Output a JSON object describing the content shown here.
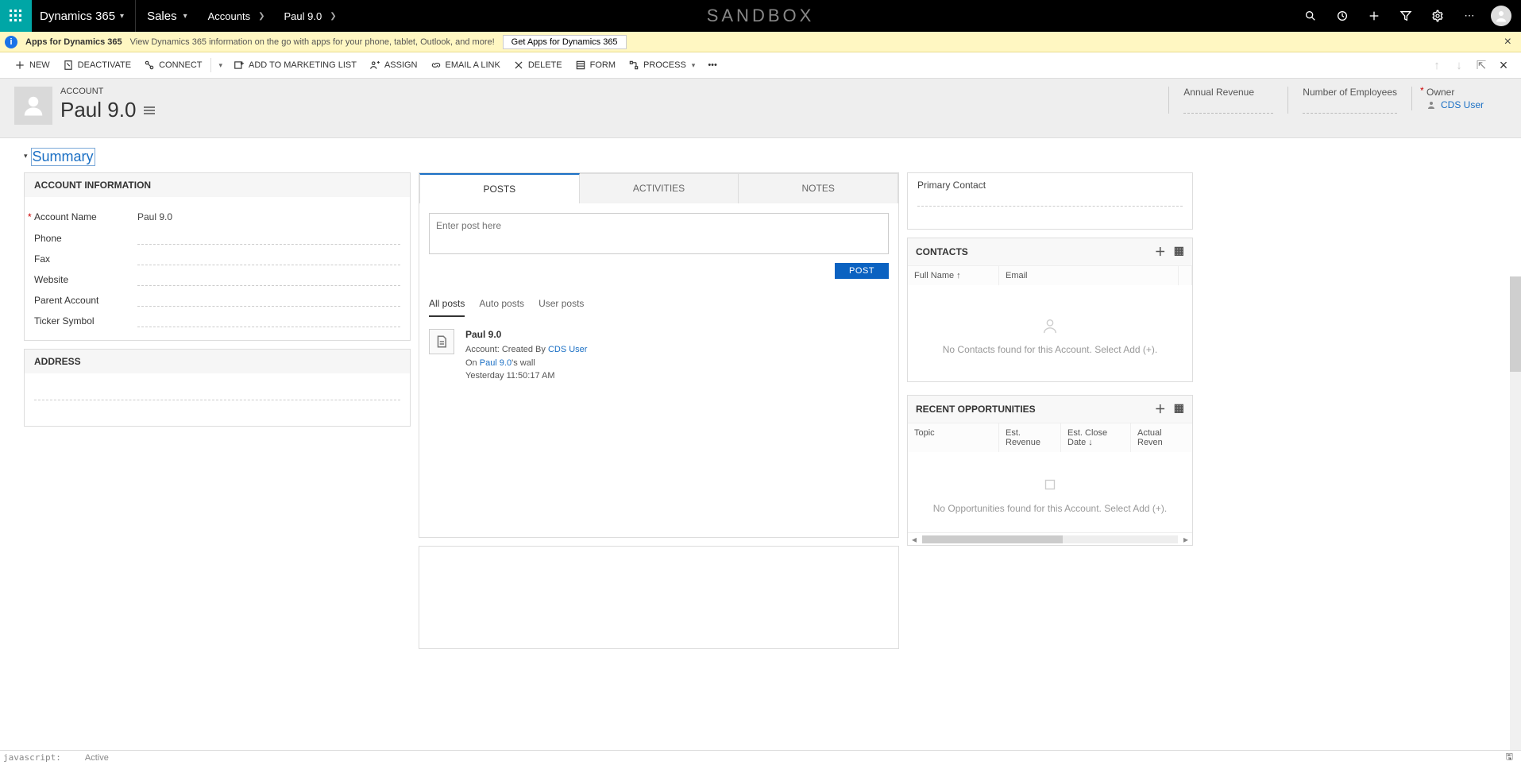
{
  "topbar": {
    "brand": "Dynamics 365",
    "area": "Sales",
    "crumb_entity": "Accounts",
    "crumb_record": "Paul 9.0",
    "env": "SANDBOX"
  },
  "infobar": {
    "title": "Apps for Dynamics 365",
    "msg": "View Dynamics 365 information on the go with apps for your phone, tablet, Outlook, and more!",
    "button": "Get Apps for Dynamics 365"
  },
  "commands": {
    "new": "New",
    "deactivate": "Deactivate",
    "connect": "Connect",
    "add_marketing": "Add to Marketing List",
    "assign": "Assign",
    "email_link": "Email a Link",
    "delete": "Delete",
    "form": "Form",
    "process": "Process"
  },
  "record": {
    "entity": "ACCOUNT",
    "name": "Paul 9.0",
    "metrics": {
      "annual_revenue_label": "Annual Revenue",
      "num_emp_label": "Number of Employees",
      "owner_label": "Owner",
      "owner_value": "CDS User"
    }
  },
  "summary": {
    "title": "Summary",
    "account_info": {
      "section": "ACCOUNT INFORMATION",
      "account_name_label": "Account Name",
      "account_name_value": "Paul 9.0",
      "phone_label": "Phone",
      "fax_label": "Fax",
      "website_label": "Website",
      "parent_label": "Parent Account",
      "ticker_label": "Ticker Symbol"
    },
    "address": {
      "section": "ADDRESS"
    }
  },
  "social": {
    "tabs": {
      "posts": "POSTS",
      "activities": "ACTIVITIES",
      "notes": "NOTES"
    },
    "placeholder": "Enter post here",
    "post_btn": "POST",
    "filter": {
      "all": "All posts",
      "auto": "Auto posts",
      "user": "User posts"
    },
    "post1": {
      "title": "Paul 9.0",
      "line1a": "Account: Created By ",
      "line1b": "CDS User",
      "line2a": "On ",
      "line2b": "Paul 9.0",
      "line2c": "'s wall",
      "line3": "Yesterday 11:50:17 AM"
    }
  },
  "right": {
    "primary_contact": "Primary Contact",
    "contacts": {
      "title": "CONTACTS",
      "col1": "Full Name ↑",
      "col2": "Email",
      "empty": "No Contacts found for this Account. Select Add (+)."
    },
    "opps": {
      "title": "RECENT OPPORTUNITIES",
      "col1": "Topic",
      "col2": "Est. Revenue",
      "col3": "Est. Close Date ↓",
      "col4": "Actual Reven",
      "empty": "No Opportunities found for this Account. Select Add (+)."
    }
  },
  "footer": {
    "left_js": "javascript:",
    "status": "Active",
    "save_icon": "💾"
  }
}
